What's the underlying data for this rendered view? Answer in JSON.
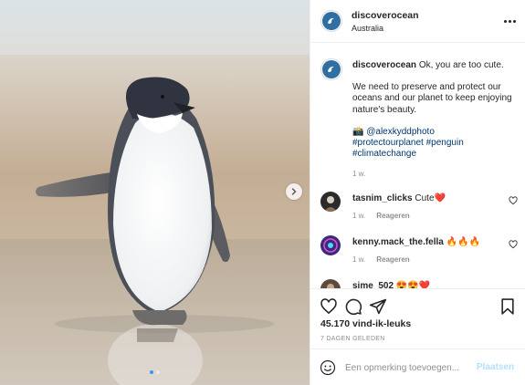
{
  "photo": {
    "alt_icon": "penguin-photo",
    "carousel_next_icon": "chevron-right-icon",
    "carousel_count": 2,
    "carousel_active": 0
  },
  "header": {
    "username": "discoverocean",
    "location": "Australia",
    "more_icon": "more-dots-icon"
  },
  "caption": {
    "username": "discoverocean",
    "line1": "Ok, you are too cute.",
    "paragraph": "We need to preserve and protect our oceans and our planet to keep enjoying nature's beauty.",
    "camera_emoji": "📸",
    "mention": "@alexkyddphoto",
    "hashtags_line1": "#protectourplanet #penguin",
    "hashtags_line2": "#climatechange",
    "time": "1 w."
  },
  "comments": [
    {
      "username": "tasnim_clicks",
      "text": "Cute❤️",
      "time": "1 w.",
      "reply": "Reageren"
    },
    {
      "username": "kenny.mack_the.fella",
      "text": "🔥🔥🔥",
      "time": "1 w.",
      "reply": "Reageren"
    },
    {
      "username": "sime_502",
      "text": "😍😍❤️"
    }
  ],
  "actions": {
    "like_icon": "heart-icon",
    "comment_icon": "comment-icon",
    "share_icon": "paper-plane-icon",
    "save_icon": "bookmark-icon",
    "likes": "45.170 vind-ik-leuks",
    "date": "7 DAGEN GELEDEN"
  },
  "add_comment": {
    "placeholder": "Een opmerking toevoegen...",
    "post_label": "Plaatsen",
    "emoji_icon": "smiley-icon"
  },
  "colors": {
    "accent_blue": "#3897f0",
    "link_blue": "#00376b",
    "post_disabled": "#b2dffc",
    "muted": "#8e8e8e",
    "border": "#efefef"
  }
}
